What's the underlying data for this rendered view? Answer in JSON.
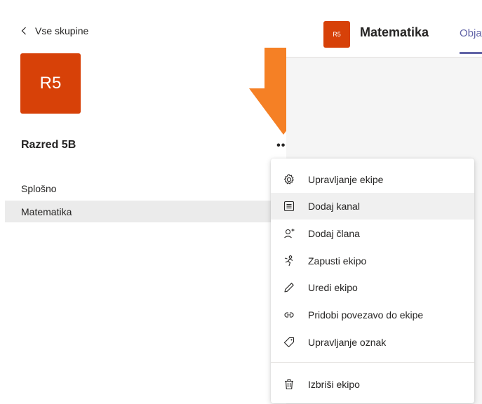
{
  "sidebar": {
    "back_label": "Vse skupine",
    "team_initials": "R5",
    "team_name": "Razred 5B",
    "more_label": "•••",
    "channels": [
      {
        "label": "Splošno",
        "selected": false
      },
      {
        "label": "Matematika",
        "selected": true
      }
    ]
  },
  "header": {
    "avatar_initials": "R5",
    "channel_name": "Matematika",
    "tab_label": "Objave"
  },
  "menu": {
    "items": [
      {
        "label": "Upravljanje ekipe",
        "icon": "gear-icon"
      },
      {
        "label": "Dodaj kanal",
        "icon": "add-channel-icon"
      },
      {
        "label": "Dodaj člana",
        "icon": "add-member-icon"
      },
      {
        "label": "Zapusti ekipo",
        "icon": "leave-icon"
      },
      {
        "label": "Uredi ekipo",
        "icon": "pencil-icon"
      },
      {
        "label": "Pridobi povezavo do ekipe",
        "icon": "link-icon"
      },
      {
        "label": "Upravljanje oznak",
        "icon": "tag-icon"
      },
      {
        "label": "Izbriši ekipo",
        "icon": "trash-icon"
      }
    ],
    "hovered_index": 1
  },
  "colors": {
    "team_avatar": "#d74108",
    "accent": "#6264a7",
    "annotation_arrow": "#f58025",
    "selected_row": "#ebebeb"
  }
}
